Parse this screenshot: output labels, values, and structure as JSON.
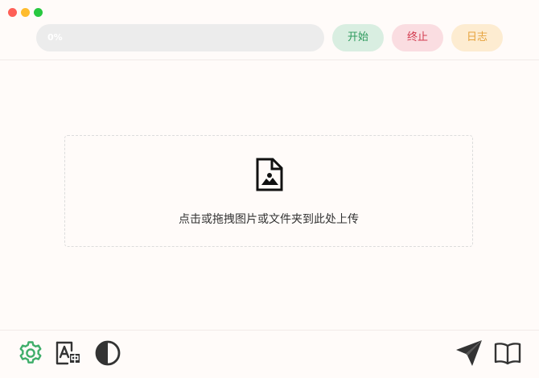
{
  "window": {
    "controls": [
      "close",
      "minimize",
      "maximize"
    ]
  },
  "toolbar": {
    "progress_value": 0,
    "progress_text": "0%",
    "start_label": "开始",
    "stop_label": "终止",
    "log_label": "日志"
  },
  "dropzone": {
    "icon": "image-file-icon",
    "text": "点击或拖拽图片或文件夹到此处上传"
  },
  "bottom_bar": {
    "left_icons": [
      "settings-icon",
      "translate-icon",
      "theme-contrast-icon"
    ],
    "right_icons": [
      "send-icon",
      "book-icon"
    ]
  },
  "colors": {
    "background": "#fffbf9",
    "progress_track": "#ececec",
    "start_bg": "#d9eee1",
    "start_fg": "#2e9a5d",
    "stop_bg": "#fadde1",
    "stop_fg": "#d23a4e",
    "log_bg": "#fdecd1",
    "log_fg": "#e6a23c",
    "settings_icon": "#3fae6a",
    "dark_icon": "#333333"
  }
}
